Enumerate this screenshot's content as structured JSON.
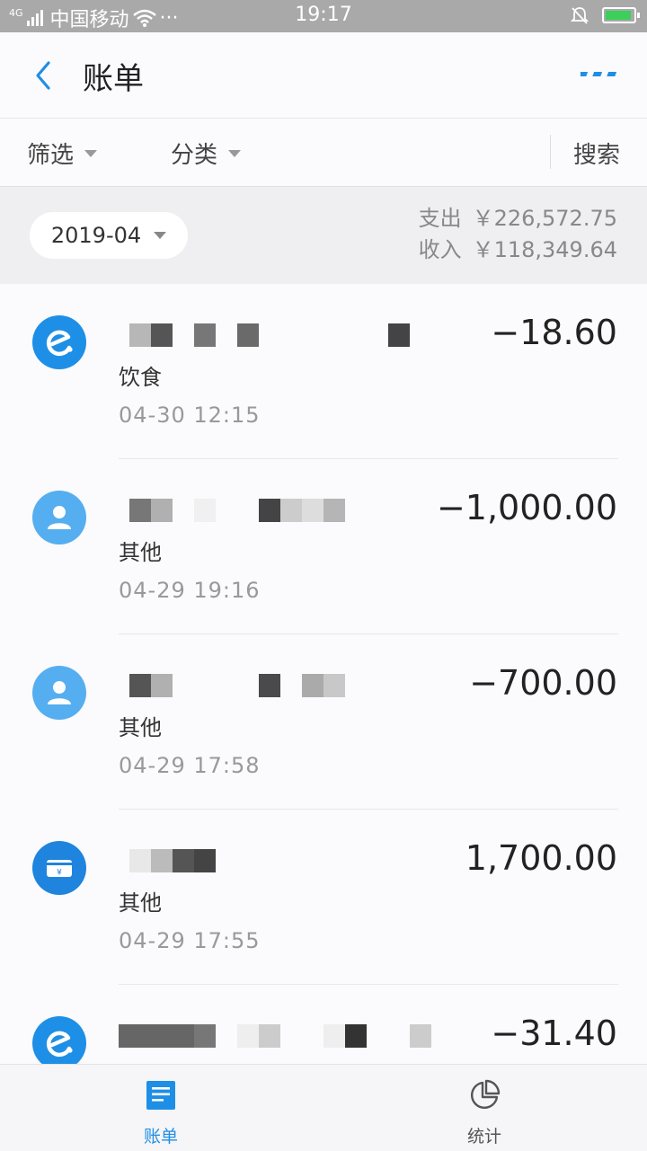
{
  "status_bar": {
    "network": "4G",
    "carrier": "中国移动",
    "dots": "···",
    "time": "19:17"
  },
  "header": {
    "title": "账单"
  },
  "filters": {
    "filter_label": "筛选",
    "category_label": "分类",
    "search_label": "搜索"
  },
  "summary": {
    "month": "2019-04",
    "expense_label": "支出",
    "expense_amount": "￥226,572.75",
    "income_label": "收入",
    "income_amount": "￥118,349.64"
  },
  "transactions": [
    {
      "icon": "eleme-icon",
      "category": "饮食",
      "time": "04-30  12:15",
      "amount": "−18.60"
    },
    {
      "icon": "person-icon",
      "category": "其他",
      "time": "04-29  19:16",
      "amount": "−1,000.00"
    },
    {
      "icon": "person-icon",
      "category": "其他",
      "time": "04-29  17:58",
      "amount": "−700.00"
    },
    {
      "icon": "bank-card-icon",
      "category": "其他",
      "time": "04-29  17:55",
      "amount": "1,700.00"
    },
    {
      "icon": "eleme-icon",
      "category": "",
      "time": "",
      "amount": "−31.40"
    }
  ],
  "bottom_nav": {
    "bills_label": "账单",
    "stats_label": "统计"
  },
  "colors": {
    "accent": "#1e8fe6",
    "status_bar": "#a9a9aa"
  }
}
